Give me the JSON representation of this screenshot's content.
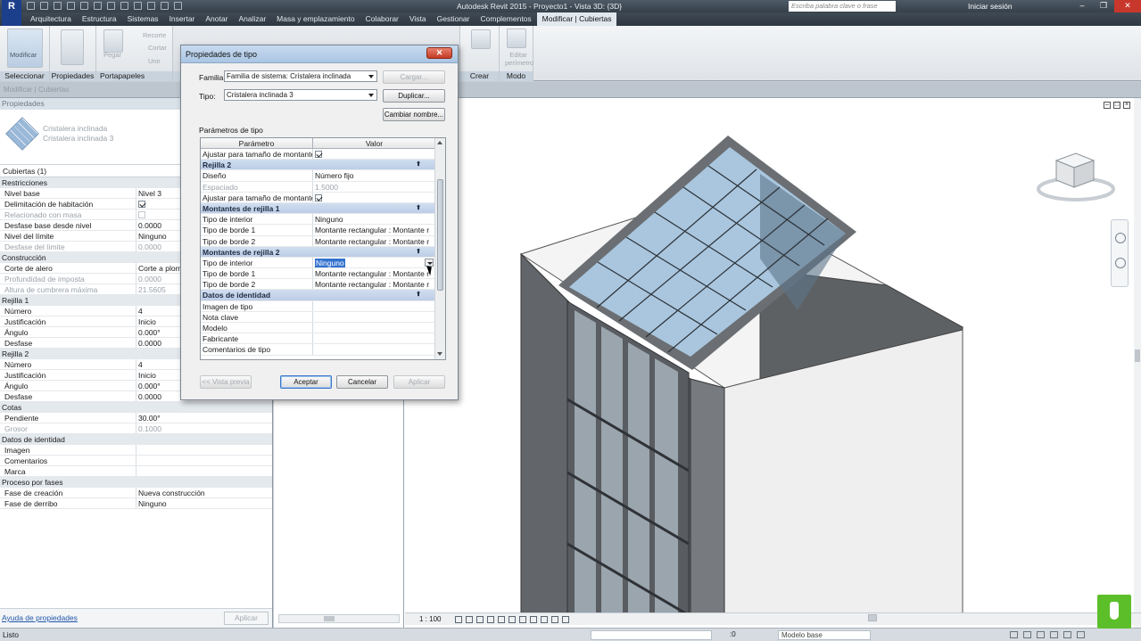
{
  "app": {
    "title": "Autodesk Revit 2015 -     Proyecto1 - Vista 3D: {3D}",
    "search_placeholder": "Escriba palabra clave o frase",
    "signin": "Iniciar sesión"
  },
  "menu": [
    "Arquitectura",
    "Estructura",
    "Sistemas",
    "Insertar",
    "Anotar",
    "Analizar",
    "Masa y emplazamiento",
    "Colaborar",
    "Vista",
    "Gestionar",
    "Complementos",
    "Modificar | Cubiertas"
  ],
  "ribbon": {
    "modificar": "Modificar",
    "pegar": "Pegar",
    "recorte": "Recorte",
    "cortar": "Cortar",
    "unir": "Unir",
    "editar_perimetro": "Editar perímetro",
    "panels": [
      "Seleccionar",
      "Propiedades",
      "Portapapeles",
      "Crear",
      "Modo"
    ]
  },
  "subbar": "Modificar | Cubiertas",
  "properties": {
    "header": "Propiedades",
    "type_family": "Cristalera inclinada",
    "type_name": "Cristalera inclinada 3",
    "filter": "Cubiertas (1)",
    "rows": [
      {
        "kind": "sec",
        "k": "Restricciones"
      },
      {
        "k": "Nivel base",
        "v": "Nivel 3"
      },
      {
        "k": "Delimitación de habitación",
        "chk": "on"
      },
      {
        "k": "Relacionado con masa",
        "chk": "dis",
        "dis": true
      },
      {
        "k": "Desfase base desde nivel",
        "v": "0.0000"
      },
      {
        "k": "Nivel del límite",
        "v": "Ninguno"
      },
      {
        "k": "Desfase del límite",
        "v": "0.0000",
        "dis": true
      },
      {
        "kind": "sec",
        "k": "Construcción"
      },
      {
        "k": "Corte de alero",
        "v": "Corte a plomo"
      },
      {
        "k": "Profundidad de imposta",
        "v": "0.0000",
        "dis": true
      },
      {
        "k": "Altura de cumbrera máxima",
        "v": "21.5605",
        "dis": true
      },
      {
        "kind": "sec",
        "k": "Rejilla 1"
      },
      {
        "k": "Número",
        "v": "4"
      },
      {
        "k": "Justificación",
        "v": "Inicio"
      },
      {
        "k": "Ángulo",
        "v": "0.000°"
      },
      {
        "k": "Desfase",
        "v": "0.0000"
      },
      {
        "kind": "sec",
        "k": "Rejilla 2"
      },
      {
        "k": "Número",
        "v": "4"
      },
      {
        "k": "Justificación",
        "v": "Inicio"
      },
      {
        "k": "Ángulo",
        "v": "0.000°"
      },
      {
        "k": "Desfase",
        "v": "0.0000"
      },
      {
        "kind": "sec",
        "k": "Cotas"
      },
      {
        "k": "Pendiente",
        "v": "30.00°"
      },
      {
        "k": "Grosor",
        "v": "0.1000",
        "dis": true
      },
      {
        "kind": "sec",
        "k": "Datos de identidad"
      },
      {
        "k": "Imagen",
        "v": ""
      },
      {
        "k": "Comentarios",
        "v": ""
      },
      {
        "k": "Marca",
        "v": ""
      },
      {
        "kind": "sec",
        "k": "Proceso por fases"
      },
      {
        "k": "Fase de creación",
        "v": "Nueva construcción"
      },
      {
        "k": "Fase de derribo",
        "v": "Ninguno"
      }
    ],
    "help_link": "Ayuda de propiedades",
    "apply": "Aplicar"
  },
  "dialog": {
    "title": "Propiedades de tipo",
    "family_label": "Familia:",
    "family_value": "Familia de sistema: Cristalera inclinada",
    "type_label": "Tipo:",
    "type_value": "Cristalera inclinada 3",
    "load": "Cargar...",
    "duplicate": "Duplicar...",
    "rename": "Cambiar nombre...",
    "params_label": "Parámetros de tipo",
    "col_param": "Parámetro",
    "col_value": "Valor",
    "rows": [
      {
        "k": "Ajustar para tamaño de montante",
        "chk": "on"
      },
      {
        "kind": "sec",
        "k": "Rejilla 2"
      },
      {
        "k": "Diseño",
        "v": "Número fijo"
      },
      {
        "k": "Espaciado",
        "v": "1.5000",
        "dis": true
      },
      {
        "k": "Ajustar para tamaño de montante",
        "chk": "on"
      },
      {
        "kind": "sec",
        "k": "Montantes de rejilla 1"
      },
      {
        "k": "Tipo de interior",
        "v": "Ninguno"
      },
      {
        "k": "Tipo de borde 1",
        "v": "Montante rectangular : Montante r"
      },
      {
        "k": "Tipo de borde 2",
        "v": "Montante rectangular : Montante r"
      },
      {
        "kind": "sec",
        "k": "Montantes de rejilla 2"
      },
      {
        "k": "Tipo de interior",
        "v": "Ninguno",
        "selected": true
      },
      {
        "k": "Tipo de borde 1",
        "v": "Montante rectangular : Montante r"
      },
      {
        "k": "Tipo de borde 2",
        "v": "Montante rectangular : Montante r"
      },
      {
        "kind": "sec",
        "k": "Datos de identidad"
      },
      {
        "k": "Imagen de tipo",
        "v": ""
      },
      {
        "k": "Nota clave",
        "v": ""
      },
      {
        "k": "Modelo",
        "v": ""
      },
      {
        "k": "Fabricante",
        "v": ""
      },
      {
        "k": "Comentarios de tipo",
        "v": ""
      }
    ],
    "preview": "<< Vista previa",
    "ok": "Aceptar",
    "cancel": "Cancelar",
    "apply": "Aplicar"
  },
  "view": {
    "scale": "1 : 100"
  },
  "status": {
    "text": "Listo",
    "zero": ":0",
    "model": "Modelo base"
  },
  "colors": {
    "glass": "#a9c6de",
    "frame": "#6b6f73",
    "wall_dark": "#5a5d60",
    "wall_light": "#efefef"
  }
}
